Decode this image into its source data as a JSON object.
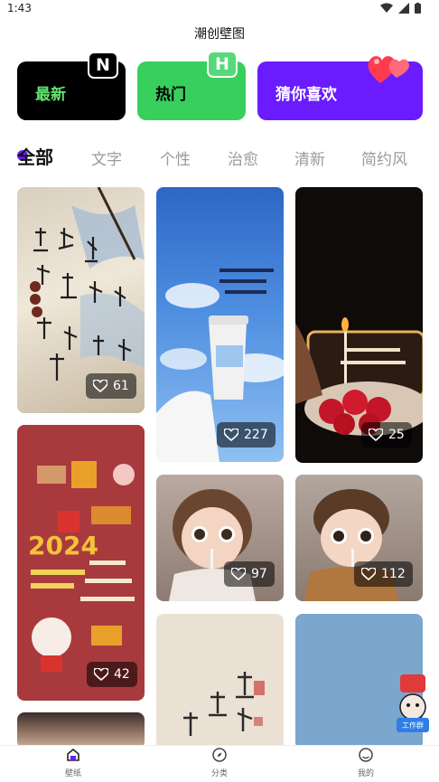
{
  "status": {
    "time": "1:43"
  },
  "app": {
    "title": "潮创壁图"
  },
  "cards": {
    "newest": {
      "label": "最新",
      "badge": "N"
    },
    "hot": {
      "label": "热门",
      "badge": "H"
    },
    "guess": {
      "label": "猜你喜欢"
    }
  },
  "tabs": [
    "全部",
    "文字",
    "个性",
    "治愈",
    "清新",
    "简约风"
  ],
  "tiles": [
    {
      "likes": "61"
    },
    {
      "likes": "227"
    },
    {
      "likes": "25"
    },
    {
      "likes": "42"
    },
    {
      "likes": "97"
    },
    {
      "likes": "112"
    }
  ],
  "nav": {
    "wallpaper": "壁纸",
    "category": "分类",
    "mine": "我的"
  },
  "float": {
    "label": "工作群"
  },
  "colors": {
    "accent": "#6a1cff",
    "green": "#37d05d",
    "newest_text": "#62e36f"
  }
}
